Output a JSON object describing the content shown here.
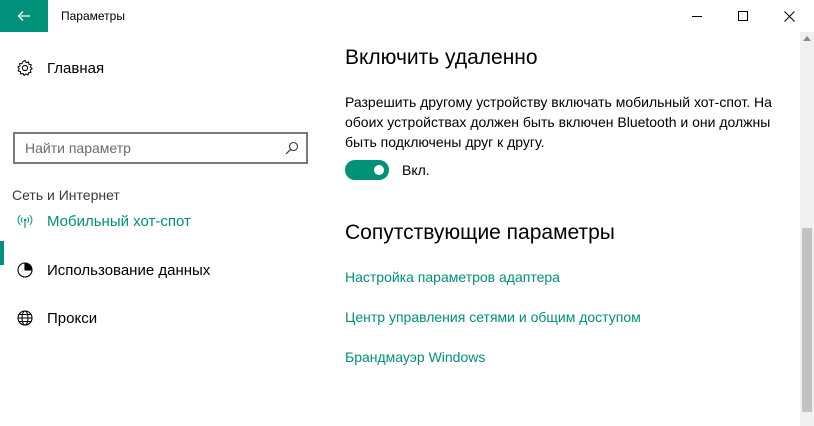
{
  "window": {
    "title": "Параметры"
  },
  "sidebar": {
    "home_label": "Главная",
    "search": {
      "placeholder": "Найти параметр"
    },
    "section_label": "Сеть и Интернет",
    "items": [
      {
        "label": "Мобильный хот-спот",
        "icon": "hotspot-icon",
        "active": true
      },
      {
        "label": "Использование данных",
        "icon": "data-usage-icon",
        "active": false
      },
      {
        "label": "Прокси",
        "icon": "globe-icon",
        "active": false
      }
    ]
  },
  "main": {
    "heading": "Включить удаленно",
    "description": "Разрешить другому устройству включать мобильный хот-спот. На обоих устройствах должен быть включен Bluetooth и они должны быть подключены друг к другу.",
    "toggle": {
      "state": true,
      "label": "Вкл."
    },
    "related_heading": "Сопутствующие параметры",
    "links": [
      "Настройка параметров адаптера",
      "Центр управления сетями и общим доступом",
      "Брандмауэр Windows"
    ]
  },
  "colors": {
    "accent": "#00917a",
    "toggle_on": "#00917a"
  }
}
